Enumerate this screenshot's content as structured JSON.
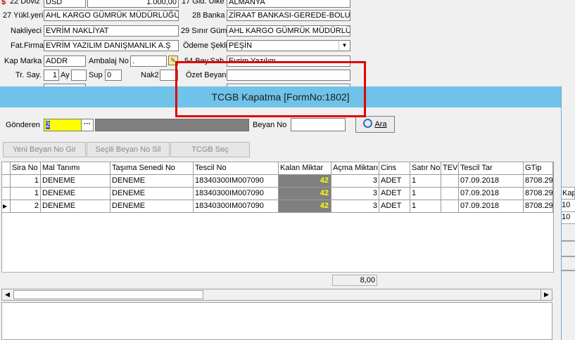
{
  "background_form": {
    "row0": {
      "doviz_label": "22 Döviz",
      "doviz_value": "USD",
      "amount": "1.000,00",
      "gid_ulke_label": "17 Gid. Ülke",
      "gid_ulke_value": "ALMANYA"
    },
    "yukleyeri_label": "27 Yükl.yeri",
    "yukleyeri_value": "AHL KARGO GÜMRÜK MÜDÜRLÜĞÜ",
    "banka_label": "28 Banka",
    "banka_value": "ZİRAAT BANKASI-GEREDE-BOLU",
    "nakliyeci_label": "Nakliyeci",
    "nakliyeci_value": "EVRİM NAKLİYAT",
    "sinir_label": "29 Sınır Güm.",
    "sinir_value": "AHL KARGO GÜMRÜK MÜDÜRLÜĞ",
    "fatfirma_label": "Fat.Firma",
    "fatfirma_value": "EVRİM YAZILIM DANIŞMANLIK A.Ş",
    "odeme_label": "Ödeme Şekli",
    "odeme_value": "PEŞİN",
    "kapmarka_label": "Kap Marka",
    "kapmarka_value": "ADDR",
    "ambalaj_label": "Ambalaj No",
    "ambalaj_value": ".",
    "beysah_label": "54 Bey.Sah.",
    "beysah_value": "Evrim Yazılım",
    "trsay_label": "Tr. Say.",
    "trsay_value": "1",
    "ay_label": "Ay",
    "sup_label": "Sup",
    "sup_value": "0",
    "nak2_label": "Nak2",
    "ozet_label": "Özet Beyan",
    "ozet_value": ""
  },
  "dialog": {
    "title": "TCGB Kapatma [FormNo:1802]",
    "gonderen_label": "Gönderen",
    "gonderen_value": "2",
    "ellipsis_label": "···",
    "beyan_no_label": "Beyan No",
    "beyan_no_value": "",
    "ara_label": "Ara",
    "yeni_beyan_label": "Yeni Beyan No Gir",
    "secili_sil_label": "Seçili Beyan No Sil",
    "tcgb_sec_label": "TCGB Seç"
  },
  "grid": {
    "columns": [
      "Sira No",
      "Mal Tanımı",
      "Taşıma Senedi No",
      "Tescil No",
      "Kalan Miktar",
      "Açma Miktarı",
      "Cins",
      "Satır No",
      "TEV",
      "Tescil Tar",
      "GTip"
    ],
    "rows": [
      [
        "1",
        "DENEME",
        "DENEME",
        "18340300IM007090",
        "42",
        "3",
        "ADET",
        "1",
        "",
        "07.09.2018",
        "8708.29"
      ],
      [
        "1",
        "DENEME",
        "DENEME",
        "18340300IM007090",
        "42",
        "3",
        "ADET",
        "1",
        "",
        "07.09.2018",
        "8708.29"
      ],
      [
        "2",
        "DENEME",
        "DENEME",
        "18340300IM007090",
        "42",
        "3",
        "ADET",
        "1",
        "",
        "07.09.2018",
        "8708.29"
      ]
    ],
    "total": "8,00"
  },
  "right_edge": {
    "kap_label": "Kap",
    "val1": "10",
    "val2": "10"
  },
  "colors": {
    "titlebar": "#6fc3e8",
    "highlight_input": "#ffff00",
    "kalan_bg": "#808080",
    "kalan_fg": "#ffff00",
    "annotation": "#e00000"
  }
}
